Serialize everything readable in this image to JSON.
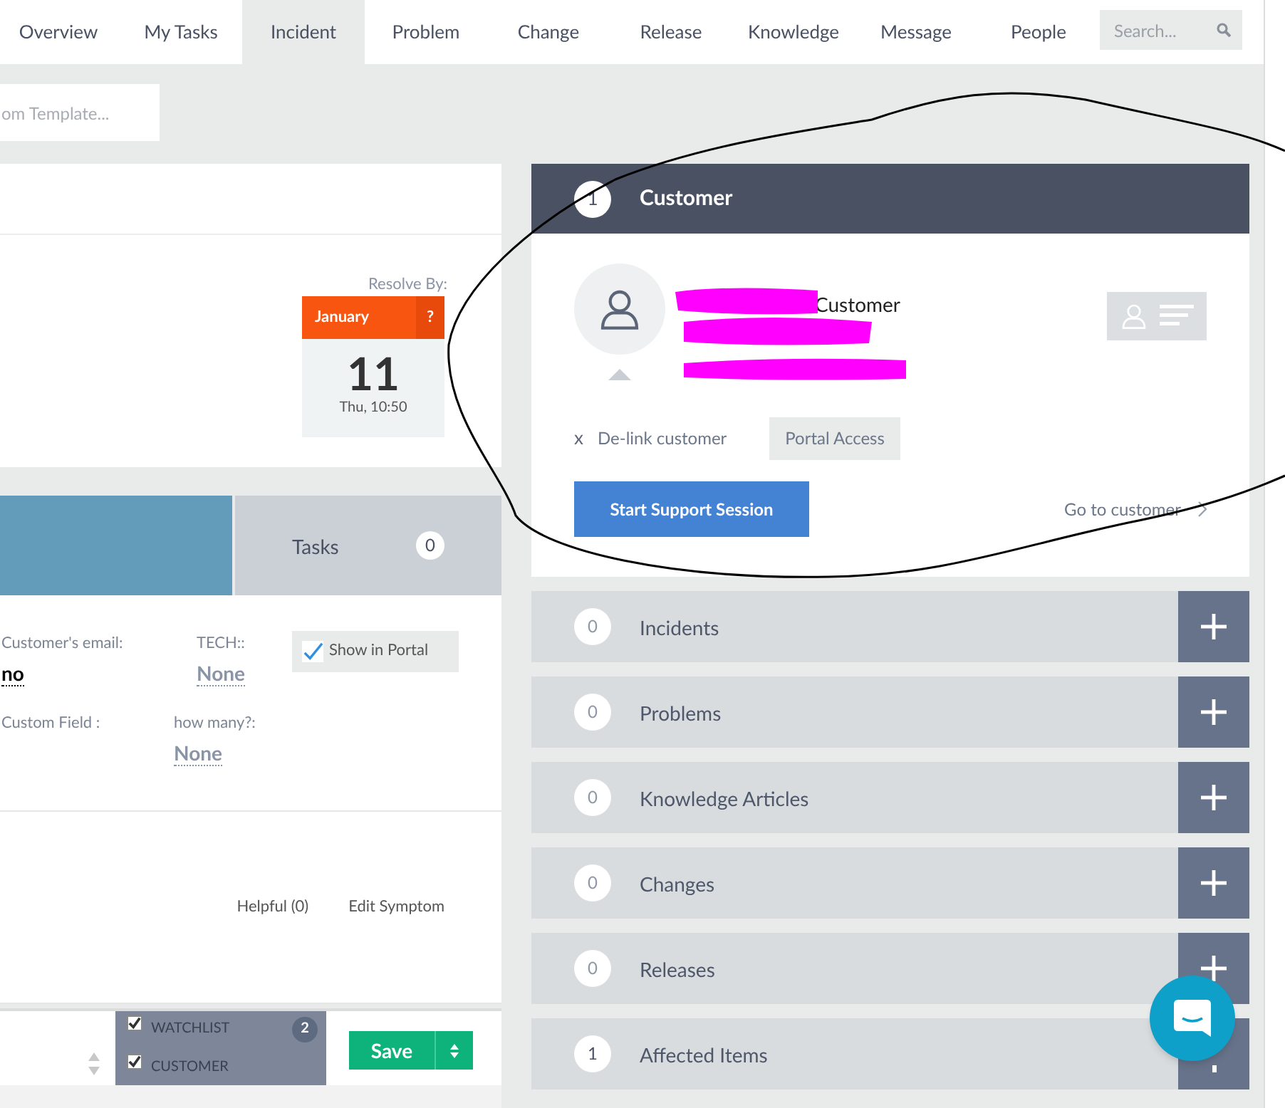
{
  "nav": {
    "tabs": [
      {
        "label": "Overview",
        "selected": false
      },
      {
        "label": "My Tasks",
        "selected": false
      },
      {
        "label": "Incident",
        "selected": true
      },
      {
        "label": "Problem",
        "selected": false
      },
      {
        "label": "Change",
        "selected": false
      },
      {
        "label": "Release",
        "selected": false
      },
      {
        "label": "Knowledge",
        "selected": false
      },
      {
        "label": "Message",
        "selected": false
      },
      {
        "label": "People",
        "selected": false
      }
    ],
    "search": {
      "placeholder": "Search..."
    }
  },
  "template_field": {
    "placeholder": "om Template..."
  },
  "resolve": {
    "label": "Resolve By:",
    "month": "January",
    "flag": "?",
    "day": "11",
    "time": "Thu, 10:50"
  },
  "section_tabs": [
    {
      "label": "Tasks",
      "count": "0",
      "selected": false
    }
  ],
  "fields": [
    {
      "label": "Customer's email:",
      "value": "no"
    },
    {
      "label": "TECH::",
      "value": "None"
    },
    {
      "label": "Custom Field :"
    },
    {
      "label": "how many?:",
      "value": "None"
    }
  ],
  "show_in_portal": {
    "label": "Show in Portal",
    "checked": true
  },
  "symptom_links": [
    "Helpful (0)",
    "Edit Symptom"
  ],
  "footer": {
    "lists": [
      {
        "label": "WATCHLIST",
        "checked": true,
        "count": "2"
      },
      {
        "label": "CUSTOMER",
        "checked": true
      }
    ],
    "save": "Save"
  },
  "customer": {
    "count": "1",
    "title": "Customer",
    "name": "Customer",
    "delink_mark": "x",
    "delink": "De-link customer",
    "portal_access": "Portal Access",
    "session": "Start Support Session",
    "go_to": "Go to customer"
  },
  "related": [
    {
      "count": "0",
      "label": "Incidents"
    },
    {
      "count": "0",
      "label": "Problems"
    },
    {
      "count": "0",
      "label": "Knowledge Articles"
    },
    {
      "count": "0",
      "label": "Changes"
    },
    {
      "count": "0",
      "label": "Releases"
    },
    {
      "count": "1",
      "label": "Affected Items"
    }
  ]
}
